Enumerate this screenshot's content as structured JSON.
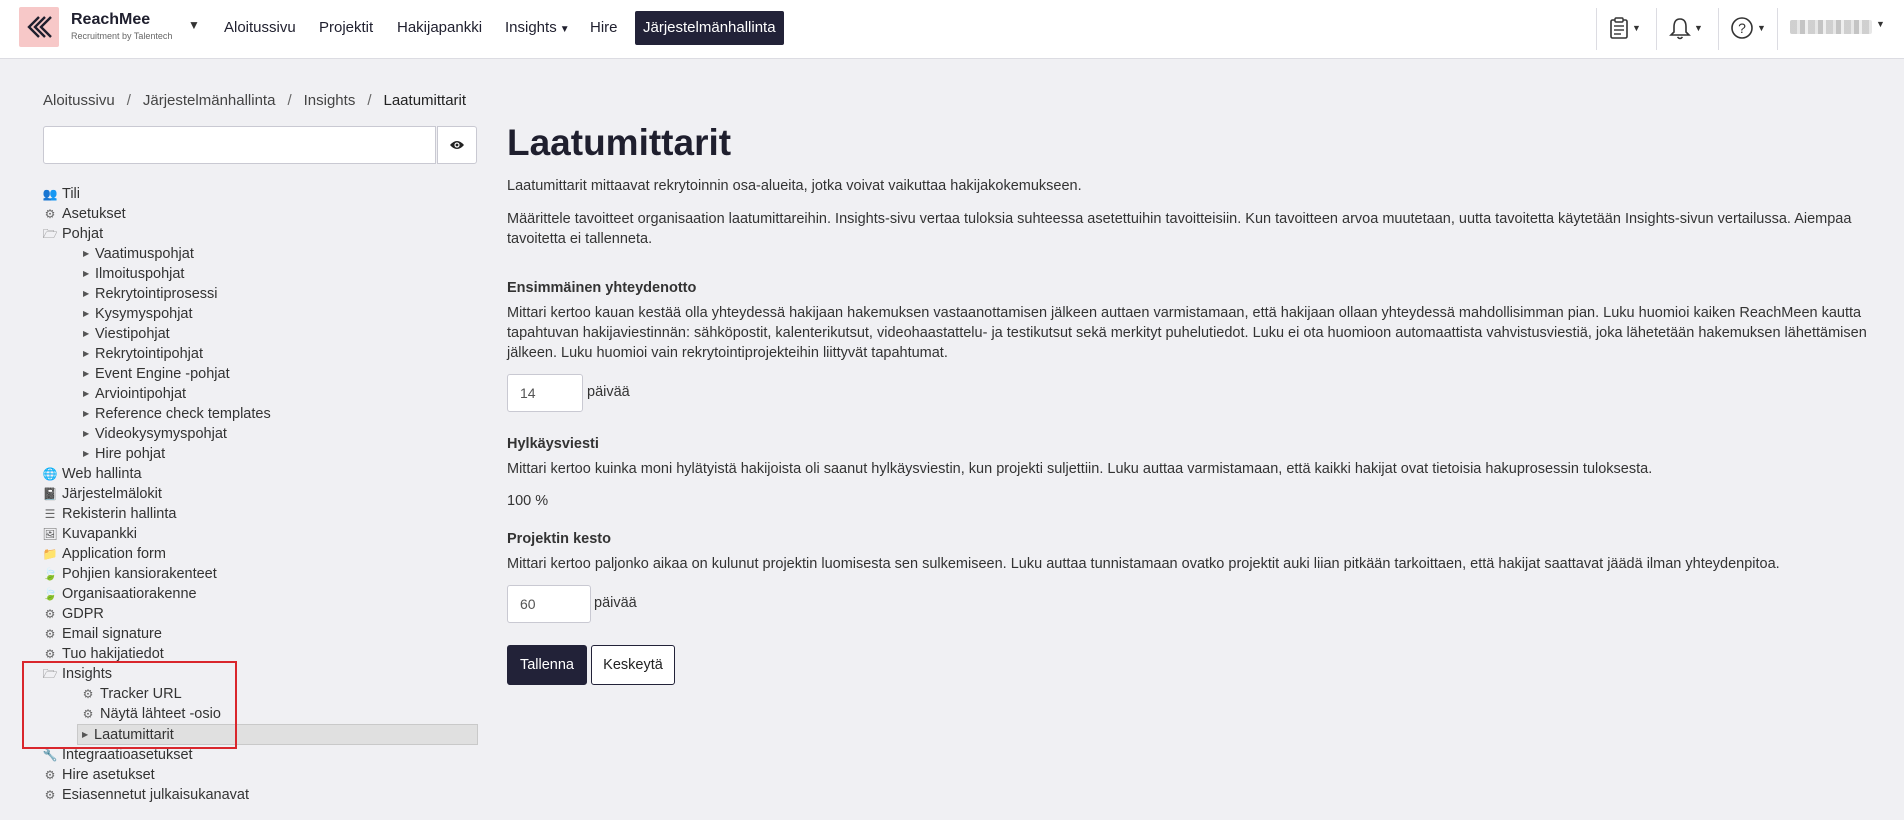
{
  "brand": {
    "name": "ReachMee",
    "sub": "Recruitment by Talentech"
  },
  "nav": [
    {
      "label": "Aloitussivu"
    },
    {
      "label": "Projektit"
    },
    {
      "label": "Hakijapankki"
    },
    {
      "label": "Insights"
    },
    {
      "label": "Hire"
    },
    {
      "label": "Järjestelmänhallinta"
    }
  ],
  "breadcrumb": [
    "Aloitussivu",
    "Järjestelmänhallinta",
    "Insights",
    "Laatumittarit"
  ],
  "sidebar": {
    "search_value": "",
    "tree": [
      {
        "label": "Tili",
        "icon": "users-icon"
      },
      {
        "label": "Asetukset",
        "icon": "gear-icon"
      },
      {
        "label": "Pohjat",
        "icon": "folder-open-icon"
      },
      {
        "label": "Vaatimuspohjat"
      },
      {
        "label": "Ilmoituspohjat"
      },
      {
        "label": "Rekrytointiprosessi"
      },
      {
        "label": "Kysymyspohjat"
      },
      {
        "label": "Viestipohjat"
      },
      {
        "label": "Rekrytointipohjat"
      },
      {
        "label": "Event Engine -pohjat"
      },
      {
        "label": "Arviointipohjat"
      },
      {
        "label": "Reference check templates"
      },
      {
        "label": "Videokysymyspohjat"
      },
      {
        "label": "Hire pohjat"
      },
      {
        "label": "Web hallinta",
        "icon": "globe-icon"
      },
      {
        "label": "Järjestelmälokit",
        "icon": "book-icon"
      },
      {
        "label": "Rekisterin hallinta",
        "icon": "list-icon"
      },
      {
        "label": "Kuvapankki",
        "icon": "image-icon"
      },
      {
        "label": "Application form",
        "icon": "folder-icon"
      },
      {
        "label": "Pohjien kansiorakenteet",
        "icon": "leaf-icon"
      },
      {
        "label": "Organisaatiorakenne",
        "icon": "leaf-icon"
      },
      {
        "label": "GDPR",
        "icon": "gear-icon"
      },
      {
        "label": "Email signature",
        "icon": "gear-icon"
      },
      {
        "label": "Tuo hakijatiedot",
        "icon": "gear-icon"
      },
      {
        "label": "Insights",
        "icon": "folder-open-icon"
      },
      {
        "label": "Tracker URL",
        "icon": "gear-icon"
      },
      {
        "label": "Näytä lähteet -osio",
        "icon": "gear-icon"
      },
      {
        "label": "Laatumittarit"
      },
      {
        "label": "Integraatioasetukset",
        "icon": "wrench-icon"
      },
      {
        "label": "Hire asetukset",
        "icon": "gear-icon"
      },
      {
        "label": "Esiasennetut julkaisukanavat",
        "icon": "gear-icon"
      }
    ]
  },
  "main": {
    "title": "Laatumittarit",
    "intro1": "Laatumittarit mittaavat rekrytoinnin osa-alueita, jotka voivat vaikuttaa hakijakokemukseen.",
    "intro2": "Määrittele tavoitteet organisaation laatumittareihin. Insights-sivu vertaa tuloksia suhteessa asetettuihin tavoitteisiin. Kun tavoitteen arvoa muutetaan, uutta tavoitetta käytetään Insights-sivun vertailussa. Aiempaa tavoitetta ei tallenneta.",
    "s1_title": "Ensimmäinen yhteydenotto",
    "s1_text": "Mittari kertoo kauan kestää olla yhteydessä hakijaan hakemuksen vastaanottamisen jälkeen auttaen varmistamaan, että hakijaan ollaan yhteydessä mahdollisimman pian. Luku huomioi kaiken ReachMeen kautta tapahtuvan hakijaviestinnän: sähköpostit, kalenterikutsut, videohaastattelu- ja testikutsut sekä merkityt puhelutiedot. Luku ei ota huomioon automaattista vahvistusviestiä, joka lähetetään hakemuksen lähettämisen jälkeen. Luku huomioi vain rekrytointiprojekteihin liittyvät tapahtumat.",
    "s1_value": "14",
    "s1_unit": "päivää",
    "s2_title": "Hylkäysviesti",
    "s2_text": "Mittari kertoo kuinka moni hylätyistä hakijoista oli saanut hylkäysviestin, kun projekti suljettiin. Luku auttaa varmistamaan, että kaikki hakijat ovat tietoisia hakuprosessin tuloksesta.",
    "s2_value": "100 %",
    "s3_title": "Projektin kesto",
    "s3_text": "Mittari kertoo paljonko aikaa on kulunut projektin luomisesta sen sulkemiseen. Luku auttaa tunnistamaan ovatko projektit auki liian pitkään tarkoittaen, että hakijat saattavat jäädä ilman yhteydenpitoa.",
    "s3_value": "60",
    "s3_unit": "päivää",
    "save": "Tallenna",
    "cancel": "Keskeytä"
  }
}
